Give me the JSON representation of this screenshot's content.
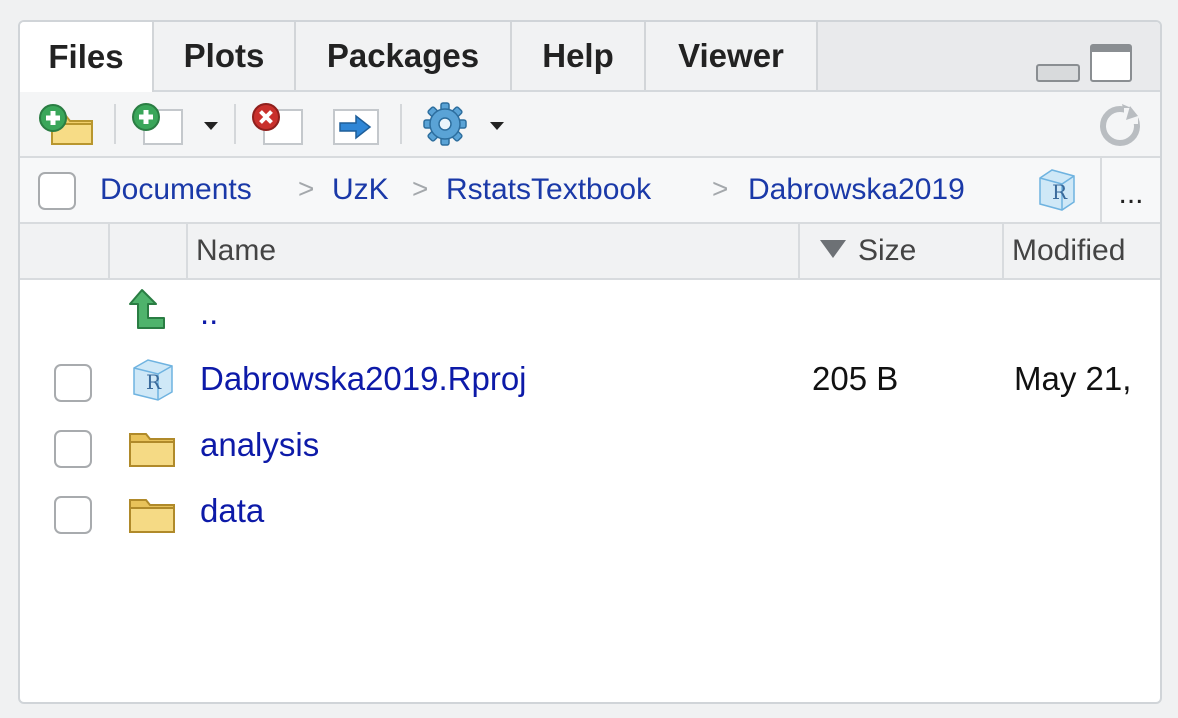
{
  "tabs": [
    {
      "label": "Files",
      "active": true
    },
    {
      "label": "Plots",
      "active": false
    },
    {
      "label": "Packages",
      "active": false
    },
    {
      "label": "Help",
      "active": false
    },
    {
      "label": "Viewer",
      "active": false
    }
  ],
  "toolbar": {
    "icons": [
      "new-folder-icon",
      "new-file-icon",
      "delete-icon",
      "rename-icon",
      "gear-icon",
      "refresh-icon"
    ]
  },
  "breadcrumb": {
    "items": [
      "Documents",
      "UzK",
      "RstatsTextbook",
      "Dabrowska2019"
    ],
    "more": "..."
  },
  "columns": {
    "name": "Name",
    "size": "Size",
    "modified": "Modified"
  },
  "rows": [
    {
      "name": "..",
      "size": "",
      "modified": "",
      "icon": "up-arrow-icon"
    },
    {
      "name": "Dabrowska2019.Rproj",
      "size": "205 B",
      "modified": "May 21,",
      "icon": "rproj-icon"
    },
    {
      "name": "analysis",
      "size": "",
      "modified": "",
      "icon": "folder-icon"
    },
    {
      "name": "data",
      "size": "",
      "modified": "",
      "icon": "folder-icon"
    }
  ],
  "colors": {
    "link": "#0d1aa8",
    "breadcrumb": "#1a39a8",
    "accent_green": "#3aa65a",
    "delete_red": "#c9302c"
  }
}
